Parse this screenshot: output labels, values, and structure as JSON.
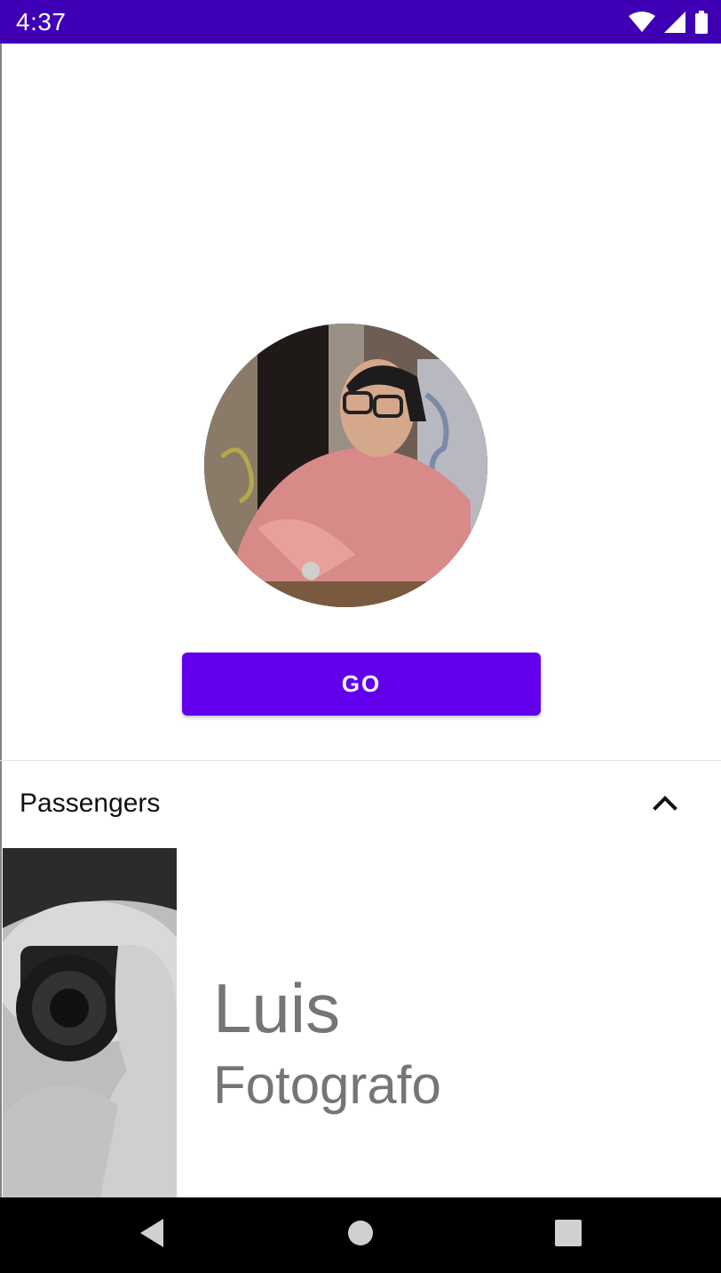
{
  "status_bar": {
    "time": "4:37",
    "icons": [
      "wifi-icon",
      "signal-icon",
      "battery-icon"
    ]
  },
  "profile": {
    "avatar_icon": "profile-photo",
    "go_label": "GO"
  },
  "passengers": {
    "title": "Passengers",
    "toggle_icon": "chevron-up-icon",
    "items": [
      {
        "name": "Luis",
        "role": "Fotografo"
      }
    ]
  },
  "nav_bar": {
    "buttons": [
      "back-icon",
      "home-icon",
      "recents-icon"
    ]
  },
  "colors": {
    "status_bar": "#3f00b5",
    "accent": "#6200ee",
    "secondary_text": "#757575",
    "nav_bar": "#000000"
  }
}
